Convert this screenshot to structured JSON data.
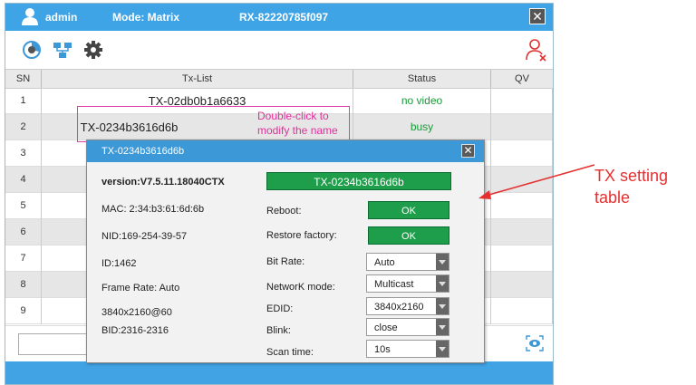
{
  "header": {
    "user": "admin",
    "mode": "Mode: Matrix",
    "device_id": "RX-82220785f097",
    "close_symbol": "✕",
    "color": "#3fa4e6"
  },
  "toolbar": {
    "icons": [
      "dashboard-icon",
      "network-topology-icon",
      "gear-icon",
      "user-remove-icon"
    ]
  },
  "table": {
    "columns": [
      "SN",
      "Tx-List",
      "Status",
      "QV"
    ],
    "rows": [
      {
        "sn": "1",
        "tx": "TX-02db0b1a6633",
        "status": "no video"
      },
      {
        "sn": "2",
        "tx": "TX-0234b3616d6b",
        "status": "busy"
      },
      {
        "sn": "3",
        "tx": "",
        "status": ""
      },
      {
        "sn": "4",
        "tx": "",
        "status": ""
      },
      {
        "sn": "5",
        "tx": "",
        "status": ""
      },
      {
        "sn": "6",
        "tx": "",
        "status": ""
      },
      {
        "sn": "7",
        "tx": "",
        "status": ""
      },
      {
        "sn": "8",
        "tx": "",
        "status": ""
      },
      {
        "sn": "9",
        "tx": "",
        "status": ""
      }
    ]
  },
  "callout": {
    "line1": "Double-click to",
    "line2": "modify the name"
  },
  "dialog": {
    "title": "TX-0234b3616d6b",
    "close_symbol": "✕",
    "left": {
      "version": "version:V7.5.11.18040CTX",
      "mac": "MAC: 2:34:b3:61:6d:6b",
      "nid": "NID:169-254-39-57",
      "id": "ID:1462",
      "frame_rate": "Frame Rate: Auto",
      "resolution": "3840x2160@60",
      "bid": "BID:2316-2316"
    },
    "name_value": "TX-0234b3616d6b",
    "settings": {
      "reboot_label": "Reboot:",
      "reboot_btn": "OK",
      "restore_label": "Restore factory:",
      "restore_btn": "OK",
      "bitrate_label": "Bit Rate:",
      "bitrate_value": "Auto",
      "network_label": "NetworK mode:",
      "network_value": "Multicast",
      "edid_label": "EDID:",
      "edid_value": "3840x2160",
      "blink_label": "Blink:",
      "blink_value": "close",
      "scan_label": "Scan time:",
      "scan_value": "10s"
    }
  },
  "annotation": {
    "line1": "TX setting",
    "line2": "table",
    "color": "#e53030"
  }
}
